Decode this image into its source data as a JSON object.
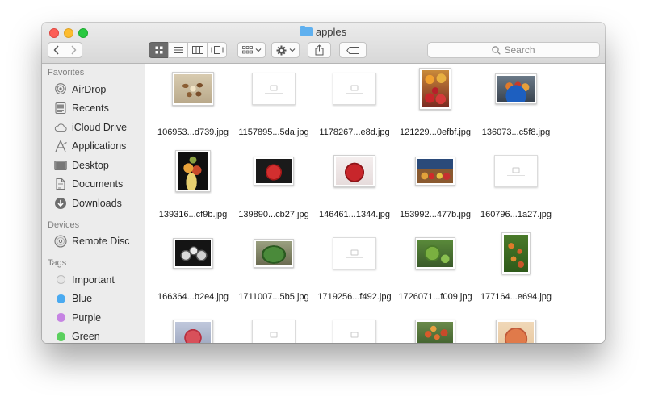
{
  "window": {
    "title": "apples"
  },
  "toolbar": {
    "back_icon": "chevron-left-icon",
    "forward_icon": "chevron-right-icon",
    "view_modes": [
      "icon-view",
      "list-view",
      "column-view",
      "cover-flow-view"
    ],
    "active_view": "icon-view",
    "search_placeholder": "Search"
  },
  "sidebar": {
    "favorites_heading": "Favorites",
    "favorites": [
      {
        "label": "AirDrop",
        "icon": "airdrop-icon"
      },
      {
        "label": "Recents",
        "icon": "recents-icon"
      },
      {
        "label": "iCloud Drive",
        "icon": "cloud-icon"
      },
      {
        "label": "Applications",
        "icon": "applications-icon"
      },
      {
        "label": "Desktop",
        "icon": "desktop-icon"
      },
      {
        "label": "Documents",
        "icon": "documents-icon"
      },
      {
        "label": "Downloads",
        "icon": "downloads-icon"
      }
    ],
    "devices_heading": "Devices",
    "devices": [
      {
        "label": "Remote Disc",
        "icon": "disc-icon"
      }
    ],
    "tags_heading": "Tags",
    "tags": [
      {
        "label": "Important",
        "color": "#e3e3e3"
      },
      {
        "label": "Blue",
        "color": "#4aaaf0"
      },
      {
        "label": "Purple",
        "color": "#c684e3"
      },
      {
        "label": "Green",
        "color": "#5bd05e"
      }
    ]
  },
  "files": [
    {
      "name": "106953...d739.jpg",
      "thumb": "seeds"
    },
    {
      "name": "1157895...5da.jpg",
      "thumb": "placeholder"
    },
    {
      "name": "1178267...e8d.jpg",
      "thumb": "placeholder"
    },
    {
      "name": "121229...0efbf.jpg",
      "thumb": "market-tall"
    },
    {
      "name": "136073...c5f8.jpg",
      "thumb": "bowl"
    },
    {
      "name": "139316...cf9b.jpg",
      "thumb": "still-life"
    },
    {
      "name": "139890...cb27.jpg",
      "thumb": "red-apple-dark"
    },
    {
      "name": "146461...1344.jpg",
      "thumb": "red-apple"
    },
    {
      "name": "153992...477b.jpg",
      "thumb": "market"
    },
    {
      "name": "160796...1a27.jpg",
      "thumb": "placeholder"
    },
    {
      "name": "166364...b2e4.jpg",
      "thumb": "bw-apples"
    },
    {
      "name": "1711007...5b5.jpg",
      "thumb": "green-bowl"
    },
    {
      "name": "1719256...f492.jpg",
      "thumb": "placeholder"
    },
    {
      "name": "1726071...f009.jpg",
      "thumb": "green-apple"
    },
    {
      "name": "177164...e694.jpg",
      "thumb": "tree"
    },
    {
      "name": "",
      "thumb": "pink-apple"
    },
    {
      "name": "",
      "thumb": "placeholder"
    },
    {
      "name": "",
      "thumb": "placeholder"
    },
    {
      "name": "",
      "thumb": "orchard"
    },
    {
      "name": "",
      "thumb": "big-apple"
    }
  ]
}
